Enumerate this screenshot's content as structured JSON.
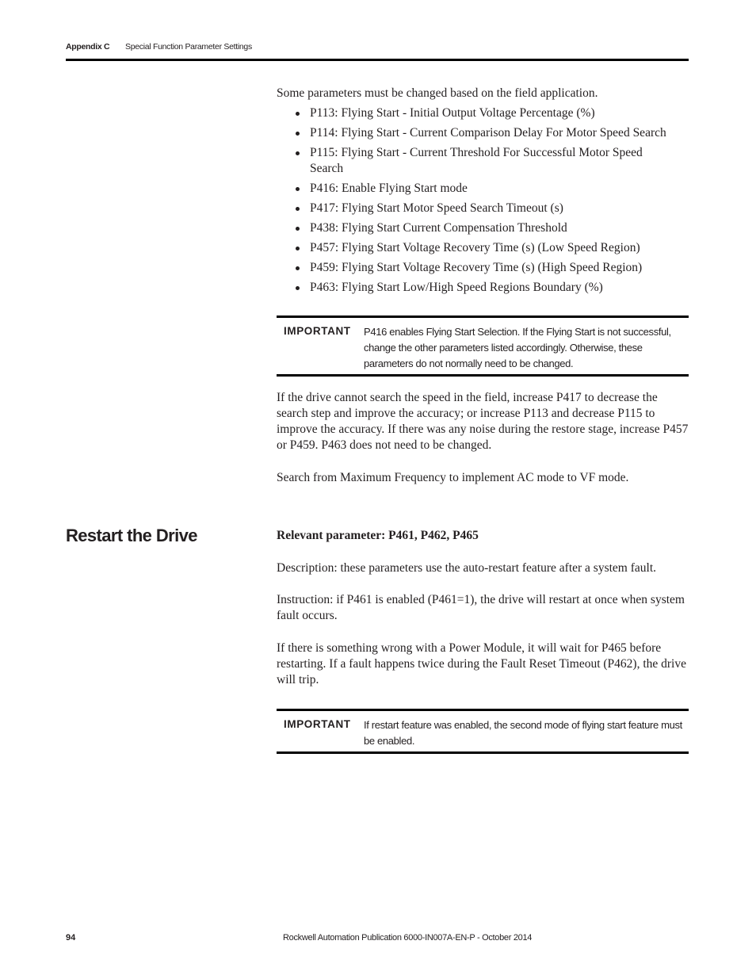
{
  "header": {
    "appendix": "Appendix C",
    "section_title": "Special Function Parameter Settings"
  },
  "intro": "Some parameters must be changed based on the field application.",
  "parameters": [
    "P113: Flying Start - Initial Output Voltage Percentage (%)",
    "P114: Flying Start - Current Comparison Delay For Motor Speed Search",
    "P115: Flying Start - Current Threshold For Successful Motor Speed Search",
    "P416: Enable Flying Start mode",
    "P417: Flying Start Motor Speed Search Timeout (s)",
    "P438: Flying Start Current Compensation Threshold",
    "P457: Flying Start Voltage Recovery Time (s) (Low Speed Region)",
    "P459: Flying Start Voltage Recovery Time (s) (High Speed Region)",
    "P463: Flying Start Low/High Speed Regions Boundary (%)"
  ],
  "important_1": {
    "label": "IMPORTANT",
    "text": "P416 enables Flying Start Selection. If the Flying Start is not successful, change the other parameters listed accordingly. Otherwise, these parameters do not normally need to be changed."
  },
  "flying_start_paragraphs": [
    "If the drive cannot search the speed in the field, increase P417 to decrease the search step and improve the accuracy; or increase P113 and decrease P115 to improve the accuracy. If there was any noise during the restore stage, increase P457 or P459. P463 does not need to be changed.",
    "Search from Maximum Frequency to implement AC mode to VF mode."
  ],
  "restart_section": {
    "heading": "Restart the Drive",
    "relevant": "Relevant parameter: P461, P462, P465",
    "description": "Description: these parameters use the auto-restart feature after a system fault.",
    "instruction": "Instruction: if P461 is enabled (P461=1), the drive will restart at once when system fault occurs.",
    "power_module": "If there is something wrong with a Power Module, it will wait for P465 before restarting. If a fault happens twice during the Fault Reset Timeout (P462), the drive will trip."
  },
  "important_2": {
    "label": "IMPORTANT",
    "text": "If restart feature was enabled, the second mode of flying start feature must be enabled."
  },
  "footer": {
    "page_number": "94",
    "publication": "Rockwell Automation Publication 6000-IN007A-EN-P - October 2014"
  }
}
